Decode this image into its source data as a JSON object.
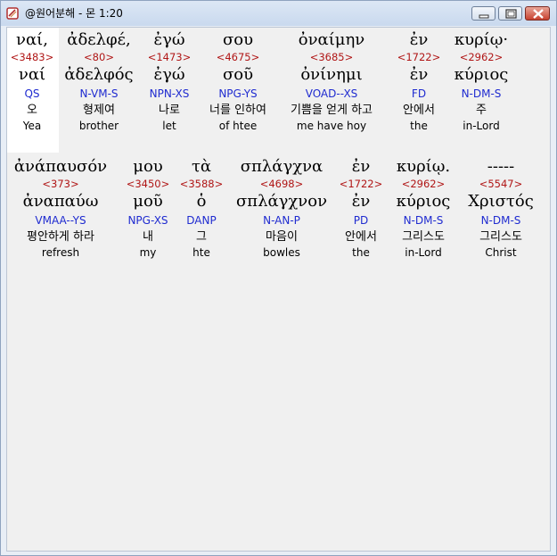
{
  "window": {
    "title": "@원어분해 - 몬 1:20",
    "controls": {
      "minimize": "minimize-icon",
      "maximize": "maximize-icon",
      "close": "close-icon"
    }
  },
  "rows": [
    {
      "words": [
        {
          "greek": "ναί,",
          "strong": "<3483>",
          "lemma": "ναί",
          "parse": "QS",
          "korean": "오",
          "english": "Yea"
        },
        {
          "greek": "ἀδελφέ,",
          "strong": "<80>",
          "lemma": "ἀδελφός",
          "parse": "N-VM-S",
          "korean": "형제여",
          "english": "brother"
        },
        {
          "greek": "ἐγώ",
          "strong": "<1473>",
          "lemma": "ἐγώ",
          "parse": "NPN-XS",
          "korean": "나로",
          "english": "let"
        },
        {
          "greek": "σου",
          "strong": "<4675>",
          "lemma": "σοῦ",
          "parse": "NPG-YS",
          "korean": "너를 인하여",
          "english": "of htee"
        },
        {
          "greek": "ὀναίμην",
          "strong": "<3685>",
          "lemma": "ὀνίνημι",
          "parse": "VOAD--XS",
          "korean": "기쁨을 얻게 하고",
          "english": "me have hoy"
        },
        {
          "greek": "ἐν",
          "strong": "<1722>",
          "lemma": "ἐν",
          "parse": "FD",
          "korean": "안에서",
          "english": "the"
        },
        {
          "greek": "κυρίῳ·",
          "strong": "<2962>",
          "lemma": "κύριος",
          "parse": "N-DM-S",
          "korean": "주",
          "english": "in-Lord"
        }
      ]
    },
    {
      "words": [
        {
          "greek": "ἀνάπαυσόν",
          "strong": "<373>",
          "lemma": "ἀναπαύω",
          "parse": "VMAA--YS",
          "korean": "평안하게 하라",
          "english": "refresh"
        },
        {
          "greek": "μου",
          "strong": "<3450>",
          "lemma": "μοῦ",
          "parse": "NPG-XS",
          "korean": "내",
          "english": "my"
        },
        {
          "greek": "τὰ",
          "strong": "<3588>",
          "lemma": "ὁ",
          "parse": "DANP",
          "korean": "그",
          "english": "hte"
        },
        {
          "greek": "σπλάγχνα",
          "strong": "<4698>",
          "lemma": "σπλάγχνον",
          "parse": "N-AN-P",
          "korean": "마음이",
          "english": "bowles"
        },
        {
          "greek": "ἐν",
          "strong": "<1722>",
          "lemma": "ἐν",
          "parse": "PD",
          "korean": "안에서",
          "english": "the"
        },
        {
          "greek": "κυρίῳ.",
          "strong": "<2962>",
          "lemma": "κύριος",
          "parse": "N-DM-S",
          "korean": "그리스도",
          "english": "in-Lord"
        },
        {
          "greek": "-----",
          "strong": "<5547>",
          "lemma": "Χριστός",
          "parse": "N-DM-S",
          "korean": "그리스도",
          "english": "Christ"
        }
      ]
    }
  ]
}
